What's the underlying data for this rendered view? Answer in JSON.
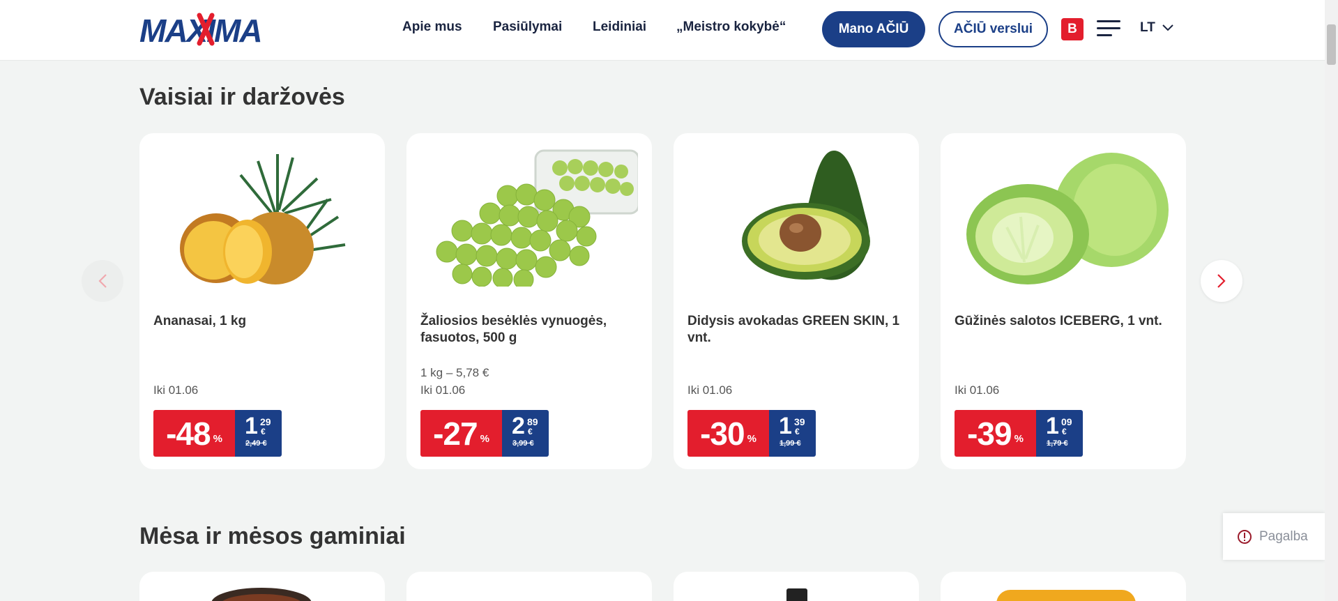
{
  "header": {
    "logo_text": "MAXIMA",
    "nav": [
      "Apie mus",
      "Pasiūlymai",
      "Leidiniai",
      "„Meistro kokybė“"
    ],
    "primary_button": "Mano AČIŪ",
    "outline_button": "AČIŪ verslui",
    "badge": "B",
    "language": "LT"
  },
  "sections": [
    {
      "title": "Vaisiai ir daržovės"
    },
    {
      "title": "Mėsa ir mėsos gaminiai"
    }
  ],
  "products": [
    {
      "name": "Ananasai, 1 kg",
      "unit_price": "",
      "valid_until": "Iki 01.06",
      "discount": "-48",
      "percent": "%",
      "price_euros": "1",
      "price_cents": "29",
      "currency": "€",
      "old_price": "2,49 €"
    },
    {
      "name": "Žaliosios besėklės vynuogės, fasuotos, 500 g",
      "unit_price": "1 kg – 5,78 €",
      "valid_until": "Iki 01.06",
      "discount": "-27",
      "percent": "%",
      "price_euros": "2",
      "price_cents": "89",
      "currency": "€",
      "old_price": "3,99 €"
    },
    {
      "name": "Didysis avokadas GREEN SKIN, 1 vnt.",
      "unit_price": "",
      "valid_until": "Iki 01.06",
      "discount": "-30",
      "percent": "%",
      "price_euros": "1",
      "price_cents": "39",
      "currency": "€",
      "old_price": "1,99 €"
    },
    {
      "name": "Gūžinės salotos ICEBERG, 1 vnt.",
      "unit_price": "",
      "valid_until": "Iki 01.06",
      "discount": "-39",
      "percent": "%",
      "price_euros": "1",
      "price_cents": "09",
      "currency": "€",
      "old_price": "1,79 €"
    }
  ],
  "help": {
    "label": "Pagalba"
  },
  "colors": {
    "brand_blue": "#1b3f87",
    "brand_red": "#e31e2d",
    "background": "#f2f4f3"
  }
}
